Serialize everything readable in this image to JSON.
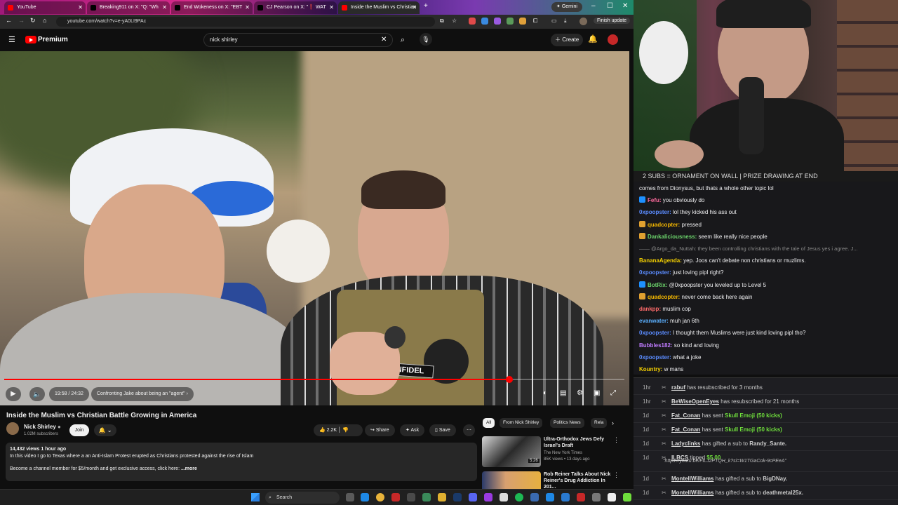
{
  "browser": {
    "tabs": [
      {
        "label": "YouTube",
        "fav": "#ff0000"
      },
      {
        "label": "Breaking911 on X: \"Q: \"Wh",
        "fav": "#000000"
      },
      {
        "label": "End Wokeness on X: \"EBT",
        "fav": "#000000"
      },
      {
        "label": "CJ Pearson on X: \"❗ WAT",
        "fav": "#000000"
      },
      {
        "label": "Inside the Muslim vs Christian",
        "fav": "#ff0000"
      }
    ],
    "gemini_label": "Gemini",
    "url": "youtube.com/watch?v=e-yA0LI9PAc",
    "finish_update": "Finish update"
  },
  "youtube": {
    "brand": "Premium",
    "search_value": "nick shirley",
    "create_label": "Create",
    "video": {
      "progress_fraction": 0.814,
      "time": "19:58 / 24:32",
      "chapter": "Confronting Jake about being an \"agent\"",
      "vest_text": "INFIDEL"
    },
    "title": "Inside the Muslim vs Christian Battle Growing in America",
    "channel": {
      "name": "Nick Shirley",
      "subscribers": "1.02M subscribers",
      "join": "Join"
    },
    "actions": {
      "likes": "2.2K",
      "share": "Share",
      "ask": "Ask",
      "save": "Save"
    },
    "description": {
      "meta": "14,432 views  1 hour ago",
      "line1": "In this video I go to Texas where a an Anti-Islam Protest erupted as Christians protested against the rise of Islam",
      "line2": "Become a channel member for $5/month and get exclusive access, click here:",
      "more": "...more"
    },
    "chips": [
      "All",
      "From Nick Shirley",
      "Politics News",
      "Rela"
    ],
    "recommendations": [
      {
        "title": "Ultra-Orthodox Jews Defy Israel's Draft",
        "channel": "The New York Times",
        "meta": "85K views • 13 days ago",
        "duration": "5:26"
      },
      {
        "title": "Rob Reiner Talks About Nick Reiner's Drug Addiction In 201...",
        "channel": "",
        "meta": "",
        "duration": ""
      }
    ]
  },
  "stream": {
    "banner": "2 SUBS = ORNAMENT ON WALL | PRIZE DRAWING AT END",
    "chat": [
      {
        "user": "",
        "msg": "comes from Dionysus, but thats a whole other topic lol",
        "color": "#efeff1",
        "badge": ""
      },
      {
        "user": "Fefu:",
        "msg": "you obviously do",
        "color": "#ff6b9e",
        "badge": "#1e90ff"
      },
      {
        "user": "0xpoopster:",
        "msg": "lol they kicked his ass out",
        "color": "#5b8cff",
        "badge": ""
      },
      {
        "user": "quadcopter:",
        "msg": "pressed",
        "color": "#f5b800",
        "badge": "#e0a030"
      },
      {
        "user": "Dankaliciousness:",
        "msg": "seem like really nice people",
        "color": "#6bd36b",
        "badge": "#e0a030"
      },
      {
        "user": "",
        "msg": "—— @Argo_da_Nuttah: they been controlling christians with the tale of Jesus yes i agree. J...",
        "color": "#8a8a8a",
        "badge": "",
        "faint": true
      },
      {
        "user": "BananaAgenda:",
        "msg": "yep. Joos can't debate non christians or muzlims.",
        "color": "#f5d000",
        "badge": ""
      },
      {
        "user": "0xpoopster:",
        "msg": "just loving pipl right?",
        "color": "#5b8cff",
        "badge": ""
      },
      {
        "user": "BotRix:",
        "msg": "@0xpoopster you leveled up to Level 5",
        "color": "#6bd36b",
        "badge": "#1e90ff"
      },
      {
        "user": "quadcopter:",
        "msg": "never come back here again",
        "color": "#f5b800",
        "badge": "#e0a030"
      },
      {
        "user": "dankpp:",
        "msg": "muslim cop",
        "color": "#ff6b6b",
        "badge": ""
      },
      {
        "user": "evanwater:",
        "msg": "muh jan 6th",
        "color": "#5bb0ff",
        "badge": ""
      },
      {
        "user": "0xpoopster:",
        "msg": "I thought them Muslims were just kind loving pipl tho?",
        "color": "#5b8cff",
        "badge": ""
      },
      {
        "user": "Bubbles182:",
        "msg": "so kind and loving",
        "color": "#c07bff",
        "badge": ""
      },
      {
        "user": "0xpoopster:",
        "msg": "what a joke",
        "color": "#5b8cff",
        "badge": ""
      },
      {
        "user": "Kountry:",
        "msg": "w mans",
        "color": "#f5d000",
        "badge": ""
      }
    ],
    "events": [
      {
        "age": "1hr",
        "user": "rabuf",
        "text": "has resubscribed for 3 months",
        "hl": ""
      },
      {
        "age": "1hr",
        "user": "BeWiseOpenEyes",
        "text": "has resubscribed for 21 months",
        "hl": ""
      },
      {
        "age": "1d",
        "user": "Fat_Conan",
        "text": "has sent",
        "hl": "Skull Emoji (50 kicks)"
      },
      {
        "age": "1d",
        "user": "Fat_Conan",
        "text": "has sent",
        "hl": "Skull Emoji (50 kicks)"
      },
      {
        "age": "1d",
        "user": "Ladyclinks",
        "text": "has gifted a sub to",
        "hl": "",
        "target": "Randy_Sante."
      },
      {
        "age": "1d",
        "user": "ILBCS",
        "text": "tipped",
        "hl": "$5.00",
        "link": "\"https://youtu.be/FiLJ2PTQH_k?si=W1TGaCok-9cPEeA\""
      },
      {
        "age": "1d",
        "user": "MontellWilliams",
        "text": "has gifted a sub to",
        "hl": "",
        "target": "BigDNay."
      },
      {
        "age": "1d",
        "user": "MontellWilliams",
        "text": "has gifted a sub to",
        "hl": "",
        "target": "deathmetal25x."
      }
    ]
  },
  "taskbar": {
    "search_placeholder": "Search"
  }
}
